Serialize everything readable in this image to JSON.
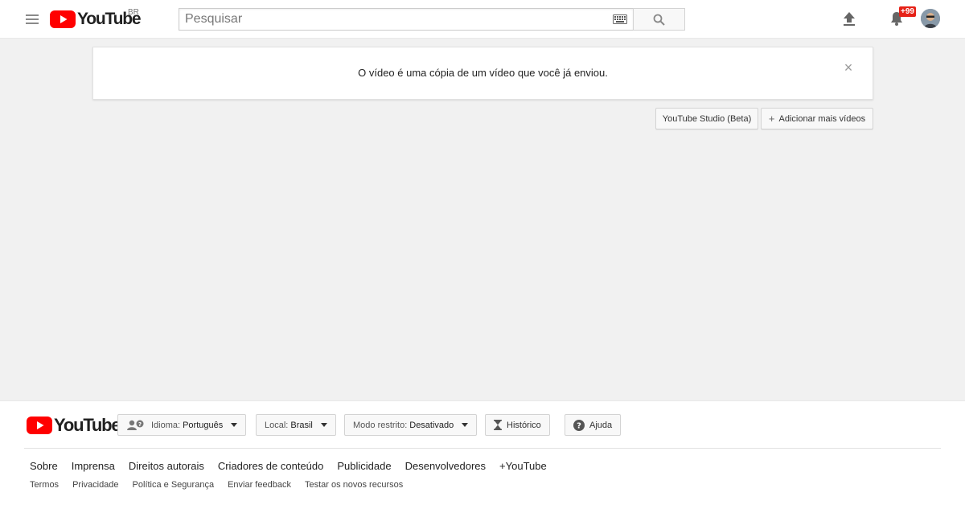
{
  "header": {
    "logo_text": "YouTube",
    "country_code": "BR",
    "search_placeholder": "Pesquisar",
    "notification_count": "+99"
  },
  "alert": {
    "message": "O vídeo é uma cópia de um vídeo que você já enviou.",
    "close_symbol": "×"
  },
  "actions": {
    "studio_label": "YouTube Studio (Beta)",
    "add_plus": "+",
    "add_label": "Adicionar mais vídeos"
  },
  "footer": {
    "logo_text": "YouTube",
    "language_label": "Idioma:",
    "language_value": "Português",
    "location_label": "Local:",
    "location_value": "Brasil",
    "restricted_label": "Modo restrito:",
    "restricted_value": "Desativado",
    "history_label": "Histórico",
    "help_label": "Ajuda",
    "primary_links": [
      "Sobre",
      "Imprensa",
      "Direitos autorais",
      "Criadores de conteúdo",
      "Publicidade",
      "Desenvolvedores",
      "+YouTube"
    ],
    "secondary_links": [
      "Termos",
      "Privacidade",
      "Política e Segurança",
      "Enviar feedback",
      "Testar os novos recursos"
    ]
  },
  "colors": {
    "brand_red": "#ff0000",
    "page_background": "#f1f1f1",
    "badge_red": "#e62117"
  },
  "icons": [
    "menu-icon",
    "youtube-play-icon",
    "keyboard-icon",
    "search-icon",
    "upload-icon",
    "bell-icon",
    "close-icon",
    "plus-icon",
    "language-icon",
    "caret-down-icon",
    "hourglass-icon",
    "help-icon"
  ]
}
